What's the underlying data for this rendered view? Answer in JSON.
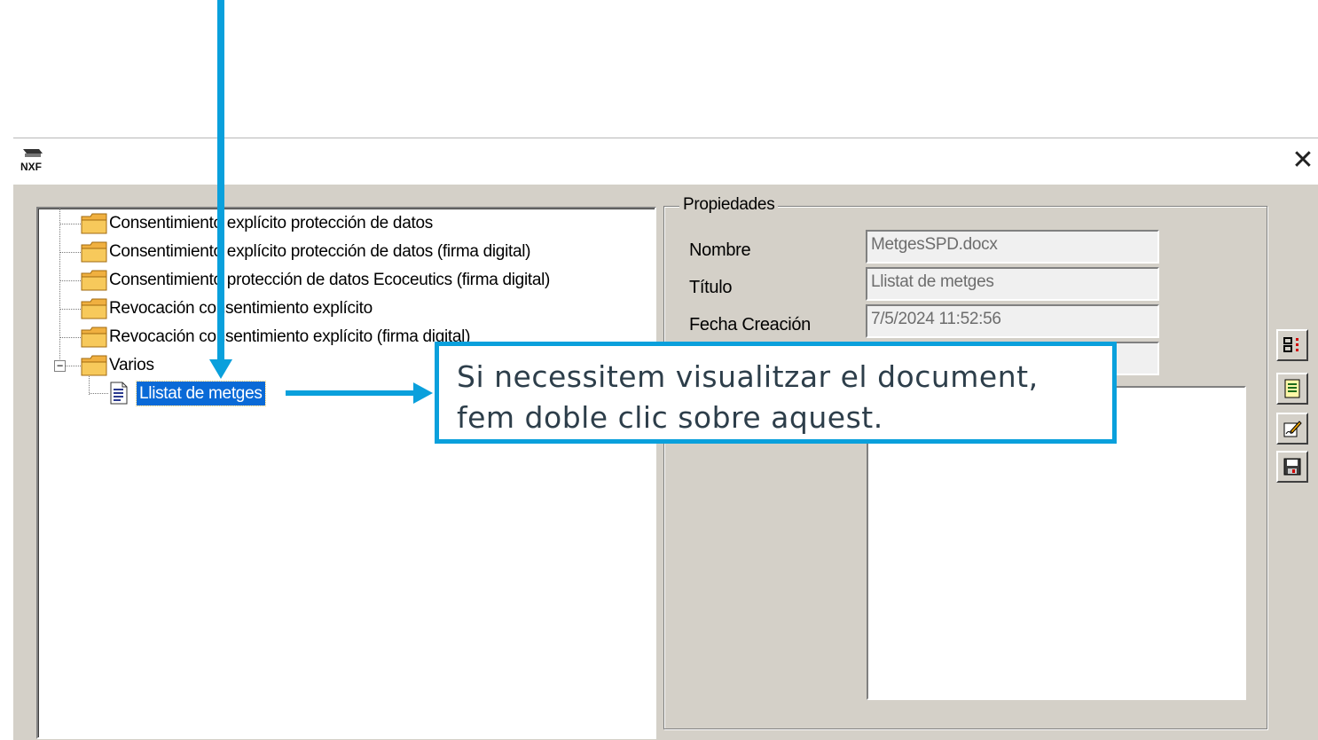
{
  "window": {
    "app_icon": "nxf-logo-icon",
    "app_icon_text": "NXF",
    "close_glyph": "✕"
  },
  "tree": {
    "items": [
      {
        "label": "Consentimiento explícito protección de datos",
        "icon": "folder-icon"
      },
      {
        "label": "Consentimiento explícito protección de datos (firma digital)",
        "icon": "folder-icon"
      },
      {
        "label": "Consentimiento protección de datos Ecoceutics (firma digital)",
        "icon": "folder-icon"
      },
      {
        "label": "Revocación consentimiento explícito",
        "icon": "folder-icon"
      },
      {
        "label": "Revocación consentimiento explícito (firma digital)",
        "icon": "folder-icon"
      },
      {
        "label": "Varios",
        "icon": "folder-icon",
        "expanded": true
      }
    ],
    "child": {
      "label": "Llistat de metges",
      "icon": "document-icon",
      "selected": true
    },
    "expander_glyph": "−"
  },
  "properties": {
    "legend": "Propiedades",
    "fields": [
      {
        "label": "Nombre",
        "value": "MetgesSPD.docx"
      },
      {
        "label": "Título",
        "value": "Llistat de metges"
      },
      {
        "label": "Fecha Creación",
        "value": "7/5/2024 11:52:56"
      },
      {
        "label": "",
        "value": ""
      }
    ]
  },
  "toolbar": {
    "buttons": [
      "properties-icon",
      "edit-document-icon",
      "sign-icon",
      "save-icon"
    ]
  },
  "annotation": {
    "callout_text": "Si necessitem visualitzar el document, fem doble clic sobre aquest.",
    "accent_color": "#0aa0dc"
  }
}
